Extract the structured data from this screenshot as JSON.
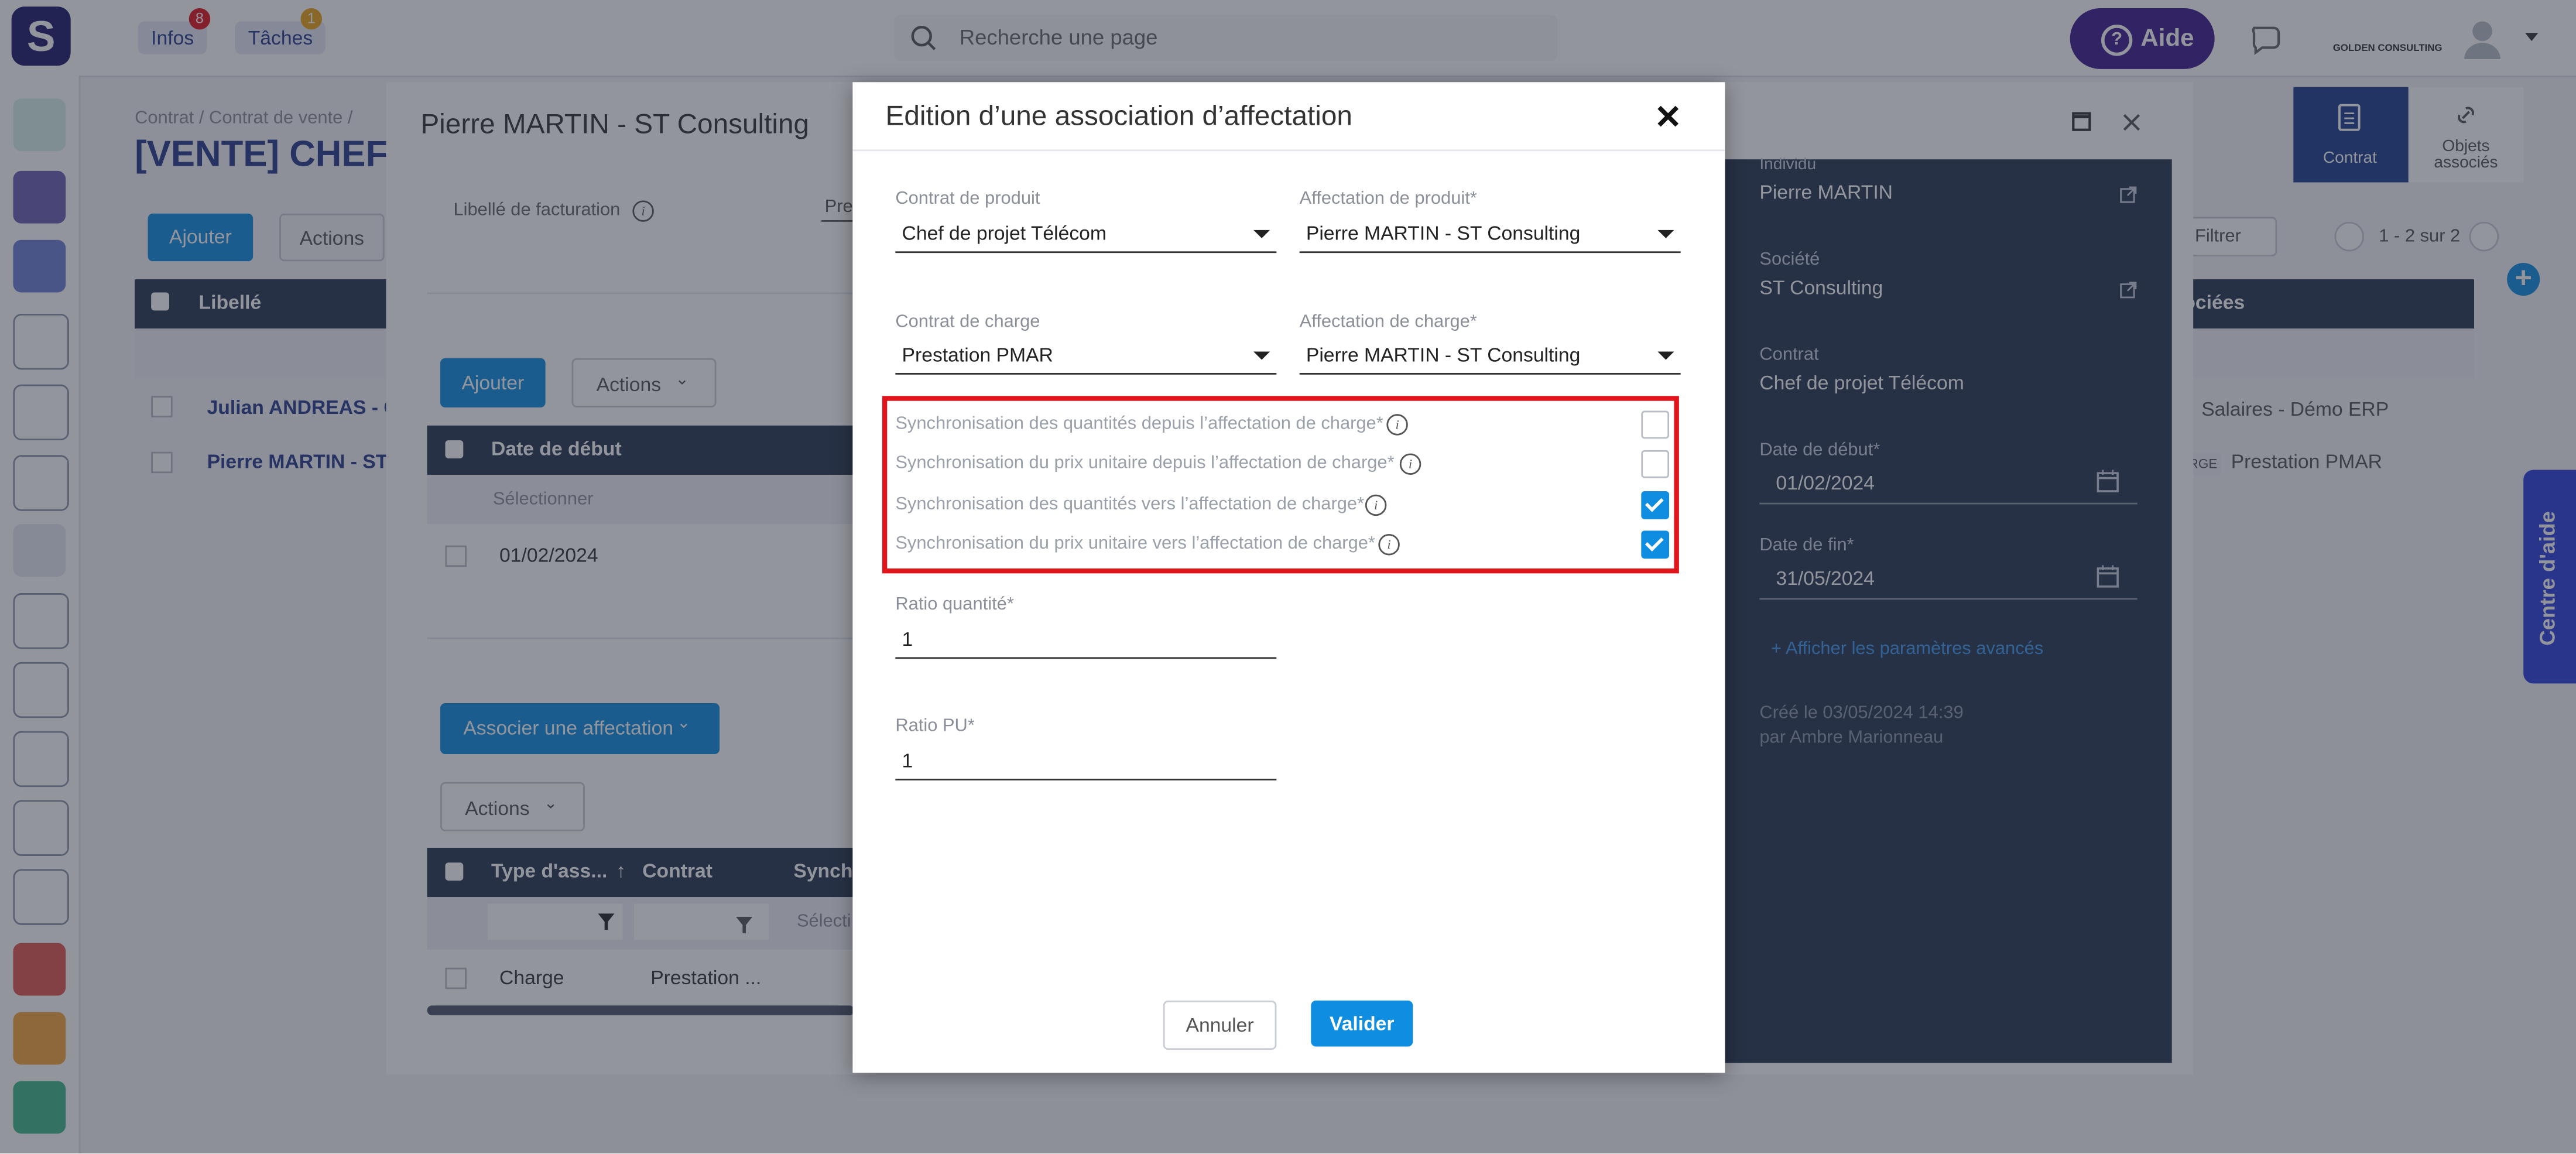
{
  "topbar": {
    "logo": "S",
    "infos_label": "Infos",
    "infos_count": "8",
    "taches_label": "Tâches",
    "taches_count": "1",
    "search_placeholder": "Recherche une page",
    "aide_label": "Aide",
    "company": "GOLDEN CONSULTING"
  },
  "background": {
    "breadcrumb": "Contrat  /  Contrat de vente /",
    "page_title": "[VENTE] CHEF",
    "ajouter": "Ajouter",
    "actions": "Actions",
    "col_libelle": "Libellé",
    "rows": [
      "Julian ANDREAS - G",
      "Pierre MARTIN - ST C"
    ],
    "tab_contrat": "Contrat",
    "tab_objets": "Objets associés",
    "filtrer": "Filtrer",
    "pagination": "1 - 2 sur 2",
    "col_associees": "ociées",
    "right_rows": [
      "Salaires - Démo ERP",
      "Prestation PMAR"
    ],
    "right_badge": "RGE",
    "centre_aide": "Centre d'aide"
  },
  "panel": {
    "title": "Pierre MARTIN - ST Consulting",
    "libelle_facturation": "Libellé de facturation",
    "libelle_value": "Pre",
    "ajouter": "Ajouter",
    "actions": "Actions",
    "col_date_debut": "Date de début",
    "filter_placeholder": "Sélectionner",
    "row_date": "01/02/2024",
    "associer": "Associer une affectation",
    "actions2": "Actions",
    "col_type": "Type d'ass...",
    "sort_arrow": "↑",
    "col_contrat": "Contrat",
    "col_synchr": "Synchr",
    "filter2": "Sélecti",
    "row_type": "Charge",
    "row_contrat": "Prestation ...",
    "individu_label": "Individu",
    "individu_value": "Pierre MARTIN",
    "societe_label": "Société",
    "societe_value": "ST Consulting",
    "contrat_label": "Contrat",
    "contrat_value": "Chef de projet Télécom",
    "date_debut_label": "Date de début*",
    "date_debut_value": "01/02/2024",
    "date_fin_label": "Date de fin*",
    "date_fin_value": "31/05/2024",
    "params_link": "Afficher les paramètres avancés",
    "cree_le": "Créé le   03/05/2024 14:39",
    "par": "par Ambre Marionneau"
  },
  "modal": {
    "title": "Edition d’une association d’affectation",
    "contrat_produit_label": "Contrat de produit",
    "contrat_produit_value": "Chef de projet Télécom",
    "affectation_produit_label": "Affectation de produit*",
    "affectation_produit_value": "Pierre MARTIN - ST Consulting",
    "contrat_charge_label": "Contrat de charge",
    "contrat_charge_value": "Prestation PMAR",
    "affectation_charge_label": "Affectation de charge*",
    "affectation_charge_value": "Pierre MARTIN - ST Consulting",
    "sync": [
      {
        "label": "Synchronisation des quantités depuis l’affectation de charge*",
        "checked": false
      },
      {
        "label": "Synchronisation du prix unitaire depuis l’affectation de charge*",
        "checked": false
      },
      {
        "label": "Synchronisation des quantités vers l’affectation de charge*",
        "checked": true
      },
      {
        "label": "Synchronisation du prix unitaire vers l’affectation de charge*",
        "checked": true
      }
    ],
    "ratio_quantite_label": "Ratio quantité*",
    "ratio_quantite_value": "1",
    "ratio_pu_label": "Ratio PU*",
    "ratio_pu_value": "1",
    "cancel_label": "Annuler",
    "validate_label": "Valider"
  },
  "colors": {
    "accent": "#0f8de0",
    "highlight": "#e0151b",
    "dark_panel": "#26364f",
    "aide": "#3b1a8c"
  }
}
